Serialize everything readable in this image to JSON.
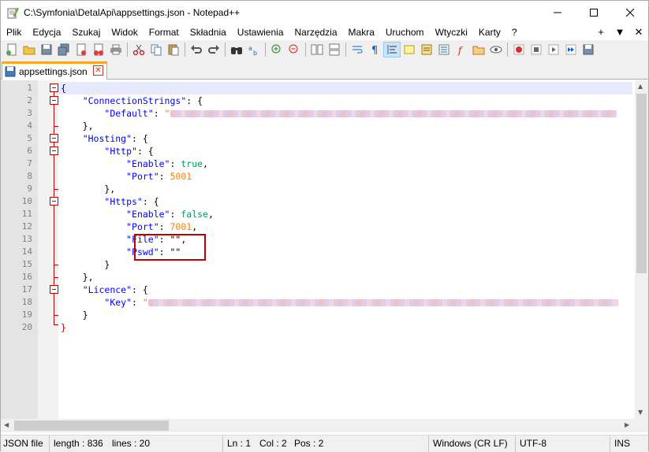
{
  "window": {
    "title": "C:\\Symfonia\\DetalApi\\appsettings.json - Notepad++"
  },
  "menu": [
    "Plik",
    "Edycja",
    "Szukaj",
    "Widok",
    "Format",
    "Składnia",
    "Ustawienia",
    "Narzędzia",
    "Makra",
    "Uruchom",
    "Wtyczki",
    "Karty",
    "?"
  ],
  "menu_right": {
    "plus": "+",
    "down": "▼",
    "close": "✕"
  },
  "tab": {
    "label": "appsettings.json"
  },
  "lines": [
    {
      "n": "1"
    },
    {
      "n": "2"
    },
    {
      "n": "3"
    },
    {
      "n": "4"
    },
    {
      "n": "5"
    },
    {
      "n": "6"
    },
    {
      "n": "7"
    },
    {
      "n": "8"
    },
    {
      "n": "9"
    },
    {
      "n": "10"
    },
    {
      "n": "11"
    },
    {
      "n": "12"
    },
    {
      "n": "13"
    },
    {
      "n": "14"
    },
    {
      "n": "15"
    },
    {
      "n": "16"
    },
    {
      "n": "17"
    },
    {
      "n": "18"
    },
    {
      "n": "19"
    },
    {
      "n": "20"
    }
  ],
  "code": {
    "l1": "{",
    "conn_key": "\"ConnectionStrings\"",
    "default_key": "\"Default\"",
    "hosting_key": "\"Hosting\"",
    "http_key": "\"Http\"",
    "enable_key": "\"Enable\"",
    "port_key": "\"Port\"",
    "true_val": "true",
    "false_val": "false",
    "port1": "5001",
    "https_key": "\"Https\"",
    "port2": "7001",
    "file_key": "\"File\"",
    "pswd_key": "\"Pswd\"",
    "empty_val": "\"\"",
    "licence_key": "\"Licence\"",
    "key_key": "\"Key\"",
    "quote": "\""
  },
  "status": {
    "type": "JSON file",
    "length": "length : 836",
    "lines": "lines : 20",
    "ln": "Ln : 1",
    "col": "Col : 2",
    "pos": "Pos : 2",
    "eol": "Windows (CR LF)",
    "enc": "UTF-8",
    "ins": "INS"
  }
}
